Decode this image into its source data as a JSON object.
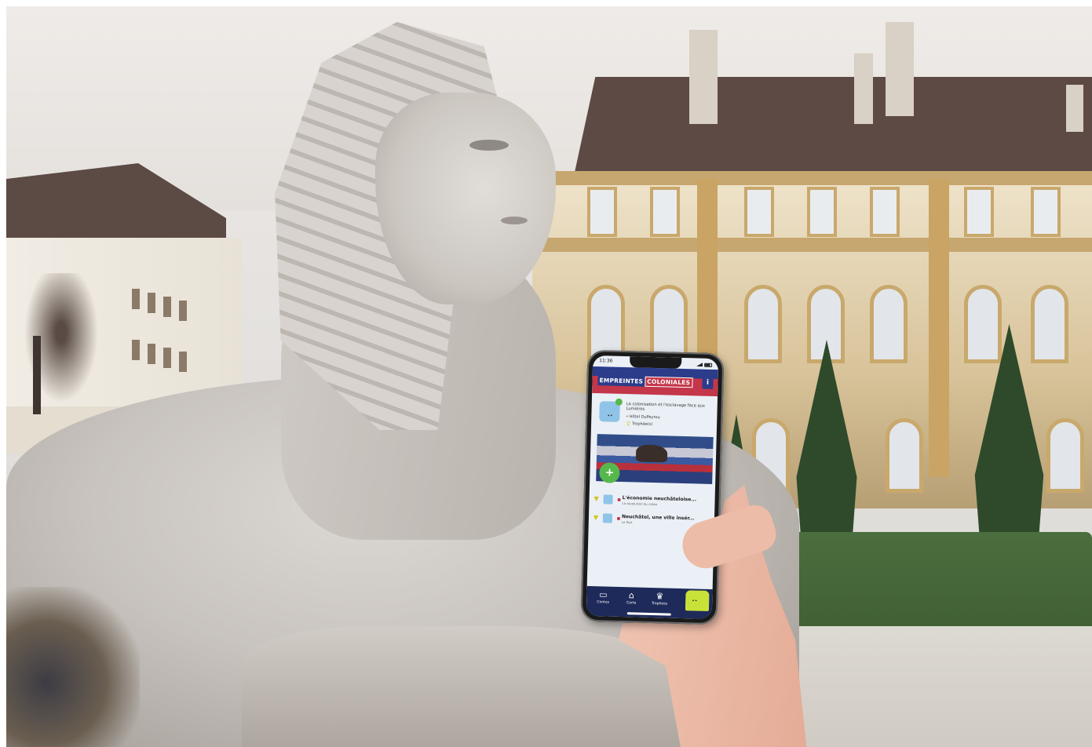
{
  "phone": {
    "status_time": "11:36",
    "app": {
      "logo_part1": "EMPREINTES",
      "logo_part2": "COLONIALES",
      "info_label": "i"
    },
    "current_card": {
      "title": "La colonisation et l'esclavage face aux Lumières",
      "location": "Hôtel DuPeyrou",
      "trophies": "Trophée(s)"
    },
    "list": [
      {
        "title": "L'économie neuchâteloise...",
        "subtitle": "La révolution du coton"
      },
      {
        "title": "Neuchâtel, une ville insér...",
        "subtitle": "Le Port"
      }
    ],
    "tabs": [
      {
        "icon": "book-icon",
        "label": "Contes"
      },
      {
        "icon": "map-icon",
        "label": "Carte"
      },
      {
        "icon": "trophy-icon",
        "label": "Trophées"
      }
    ],
    "colors": {
      "brand_blue": "#2b3c8a",
      "brand_red": "#c4364a",
      "play_green": "#56b84c",
      "mascot_yellow": "#c9e23a"
    }
  }
}
